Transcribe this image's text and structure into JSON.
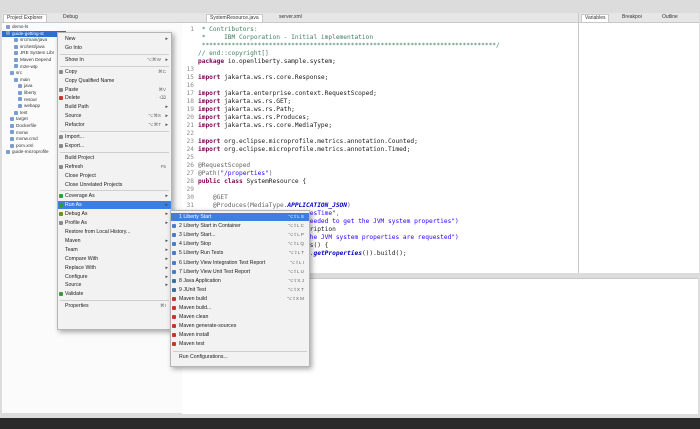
{
  "explorer": {
    "tabs": [
      "Project Explorer",
      "Debug"
    ],
    "tree": [
      {
        "label": "demo-ls",
        "selected": false,
        "indent": 1
      },
      {
        "label": "guide-getting-st",
        "selected": true,
        "indent": 1
      },
      {
        "label": "src/main/java",
        "indent": 3
      },
      {
        "label": "src/test/java",
        "indent": 3
      },
      {
        "label": "JRE System Libr",
        "indent": 3
      },
      {
        "label": "Maven Depend",
        "indent": 3
      },
      {
        "label": "m2e-wtp",
        "indent": 3
      },
      {
        "label": "src",
        "indent": 2
      },
      {
        "label": "main",
        "indent": 3
      },
      {
        "label": "java",
        "indent": 4
      },
      {
        "label": "liberty",
        "indent": 4
      },
      {
        "label": "resour",
        "indent": 4
      },
      {
        "label": "webapp",
        "indent": 4
      },
      {
        "label": "test",
        "indent": 3
      },
      {
        "label": "target",
        "indent": 2
      },
      {
        "label": "Dockerfile",
        "indent": 2
      },
      {
        "label": "mvnw",
        "indent": 2
      },
      {
        "label": "mvnw.cmd",
        "indent": 2
      },
      {
        "label": "pom.xml",
        "indent": 2
      },
      {
        "label": "guide-microprofile",
        "indent": 1
      }
    ]
  },
  "editor": {
    "tabs": [
      "SystemResource.java",
      "server.xml"
    ],
    "right_tabs": [
      "Variables",
      "Breakpoi",
      "Outline"
    ],
    "lines": [
      {
        "n": "1",
        "parts": [
          {
            "t": " * Contributors:",
            "c": "cm"
          }
        ]
      },
      {
        "n": "",
        "parts": [
          {
            "t": " *     IBM Corporation - Initial implementation",
            "c": "cm"
          }
        ]
      },
      {
        "n": "",
        "parts": [
          {
            "t": " *******************************************************************************/",
            "c": "cm"
          }
        ]
      },
      {
        "n": "",
        "parts": [
          {
            "t": "// end::copyright[]",
            "c": "cm"
          }
        ]
      },
      {
        "n": "",
        "parts": [
          {
            "t": "package ",
            "c": "kw"
          },
          {
            "t": "io.openliberty.sample.system;",
            "c": ""
          }
        ]
      },
      {
        "n": "13",
        "parts": []
      },
      {
        "n": "15",
        "parts": [
          {
            "t": "import ",
            "c": "kw"
          },
          {
            "t": "jakarta.ws.rs.core.Response;",
            "c": ""
          }
        ]
      },
      {
        "n": "16",
        "parts": []
      },
      {
        "n": "17",
        "parts": [
          {
            "t": "import ",
            "c": "kw"
          },
          {
            "t": "jakarta.enterprise.context.RequestScoped;",
            "c": ""
          }
        ]
      },
      {
        "n": "18",
        "parts": [
          {
            "t": "import ",
            "c": "kw"
          },
          {
            "t": "jakarta.ws.rs.GET;",
            "c": ""
          }
        ]
      },
      {
        "n": "19",
        "parts": [
          {
            "t": "import ",
            "c": "kw"
          },
          {
            "t": "jakarta.ws.rs.Path;",
            "c": ""
          }
        ]
      },
      {
        "n": "20",
        "parts": [
          {
            "t": "import ",
            "c": "kw"
          },
          {
            "t": "jakarta.ws.rs.Produces;",
            "c": ""
          }
        ]
      },
      {
        "n": "21",
        "parts": [
          {
            "t": "import ",
            "c": "kw"
          },
          {
            "t": "jakarta.ws.rs.core.MediaType;",
            "c": ""
          }
        ]
      },
      {
        "n": "22",
        "parts": []
      },
      {
        "n": "23",
        "parts": [
          {
            "t": "import ",
            "c": "kw"
          },
          {
            "t": "org.eclipse.microprofile.metrics.annotation.Counted;",
            "c": ""
          }
        ]
      },
      {
        "n": "24",
        "parts": [
          {
            "t": "import ",
            "c": "kw"
          },
          {
            "t": "org.eclipse.microprofile.metrics.annotation.Timed;",
            "c": ""
          }
        ]
      },
      {
        "n": "25",
        "parts": []
      },
      {
        "n": "26",
        "parts": [
          {
            "t": "@RequestScoped",
            "c": "an"
          }
        ]
      },
      {
        "n": "27",
        "parts": [
          {
            "t": "@Path(",
            "c": "an"
          },
          {
            "t": "\"/properties\"",
            "c": "st"
          },
          {
            "t": ")",
            "c": "an"
          }
        ]
      },
      {
        "n": "28",
        "parts": [
          {
            "t": "public class ",
            "c": "kw"
          },
          {
            "t": "SystemResource {",
            "c": ""
          }
        ]
      },
      {
        "n": "29",
        "parts": []
      },
      {
        "n": "30",
        "parts": [
          {
            "t": "    @GET",
            "c": "an"
          }
        ]
      },
      {
        "n": "31",
        "parts": [
          {
            "t": "    @Produces(MediaType.",
            "c": "an"
          },
          {
            "t": "APPLICATION_JSON",
            "c": "fd"
          },
          {
            "t": ")",
            "c": "an"
          }
        ]
      },
      {
        "n": "32",
        "parts": [
          {
            "t": "    @Timed(name = ",
            "c": "an"
          },
          {
            "t": "\"getPropertiesTime\"",
            "c": "st"
          },
          {
            "t": ",",
            "c": "an"
          }
        ]
      },
      {
        "n": "33",
        "parts": [
          {
            "t": "                          ",
            "c": ""
          },
          {
            "t": "ne needed to get the JVM system properties\")",
            "c": "st"
          }
        ]
      },
      {
        "n": "34",
        "parts": [
          {
            "t": "                          ",
            "c": ""
          },
          {
            "t": "description",
            "c": ""
          }
        ]
      },
      {
        "n": "35",
        "parts": [
          {
            "t": "                          ",
            "c": ""
          },
          {
            "t": "es the JVM system properties are requested\")",
            "c": "st"
          }
        ]
      },
      {
        "n": "36",
        "parts": [
          {
            "t": "                          ",
            "c": ""
          },
          {
            "t": "rties() {",
            "c": ""
          }
        ]
      },
      {
        "n": "37",
        "parts": [
          {
            "t": "                          ",
            "c": ""
          },
          {
            "t": "stem.",
            "c": ""
          },
          {
            "t": "getProperties",
            "c": "fd"
          },
          {
            "t": "()).build();",
            "c": ""
          }
        ]
      },
      {
        "n": "38",
        "parts": []
      }
    ]
  },
  "context_menu": {
    "items": [
      {
        "label": "New",
        "arrow": true
      },
      {
        "label": "Go Into"
      },
      {
        "sep": true
      },
      {
        "label": "Show In",
        "shortcut": "⌥⌘W",
        "arrow": true
      },
      {
        "sep": true
      },
      {
        "label": "Copy",
        "shortcut": "⌘C",
        "icon": "copy-icon"
      },
      {
        "label": "Copy Qualified Name"
      },
      {
        "label": "Paste",
        "shortcut": "⌘V",
        "icon": "paste-icon"
      },
      {
        "label": "Delete",
        "shortcut": "⌫",
        "icon": "delete-icon"
      },
      {
        "label": "Build Path",
        "arrow": true
      },
      {
        "label": "Source",
        "shortcut": "⌥⌘S",
        "arrow": true
      },
      {
        "label": "Refactor",
        "shortcut": "⌥⌘T",
        "arrow": true
      },
      {
        "sep": true
      },
      {
        "label": "Import...",
        "icon": "import-icon"
      },
      {
        "label": "Export...",
        "icon": "export-icon"
      },
      {
        "sep": true
      },
      {
        "label": "Build Project"
      },
      {
        "label": "Refresh",
        "shortcut": "F5",
        "icon": "refresh-icon"
      },
      {
        "label": "Close Project"
      },
      {
        "label": "Close Unrelated Projects"
      },
      {
        "sep": true
      },
      {
        "label": "Coverage As",
        "arrow": true,
        "icon": "coverage-icon"
      },
      {
        "label": "Run As",
        "arrow": true,
        "icon": "run-icon",
        "highlight": true
      },
      {
        "label": "Debug As",
        "arrow": true,
        "icon": "debug-icon"
      },
      {
        "label": "Profile As",
        "arrow": true,
        "icon": "profile-icon"
      },
      {
        "label": "Restore from Local History..."
      },
      {
        "label": "Maven",
        "arrow": true
      },
      {
        "label": "Team",
        "arrow": true
      },
      {
        "label": "Compare With",
        "arrow": true
      },
      {
        "label": "Replace With",
        "arrow": true
      },
      {
        "label": "Configure",
        "arrow": true
      },
      {
        "label": "Source",
        "arrow": true
      },
      {
        "label": "Validate",
        "icon": "check-icon"
      },
      {
        "sep": true
      },
      {
        "label": "Properties",
        "shortcut": "⌘I"
      }
    ]
  },
  "run_as_menu": {
    "items": [
      {
        "label": "1 Liberty Start",
        "shortcut": "⌥⇧L S",
        "icon": "liberty-icon",
        "highlight": true
      },
      {
        "label": "2 Liberty Start in Container",
        "shortcut": "⌥⇧L C",
        "icon": "liberty-icon"
      },
      {
        "label": "3 Liberty Start...",
        "shortcut": "⌥⇧L P",
        "icon": "liberty-icon"
      },
      {
        "label": "4 Liberty Stop",
        "shortcut": "⌥⇧L Q",
        "icon": "liberty-icon"
      },
      {
        "label": "5 Liberty Run Tests",
        "shortcut": "⌥⇧L T",
        "icon": "liberty-icon"
      },
      {
        "label": "6 Liberty View Integration Test Report",
        "shortcut": "⌥⇧L I",
        "icon": "liberty-icon"
      },
      {
        "label": "7 Liberty View Unit Test Report",
        "shortcut": "⌥⇧L U",
        "icon": "liberty-icon"
      },
      {
        "label": "8 Java Application",
        "shortcut": "⌥⇧X J",
        "icon": "java-icon"
      },
      {
        "label": "9 JUnit Test",
        "shortcut": "⌥⇧X T",
        "icon": "junit-icon"
      },
      {
        "label": "Maven build",
        "shortcut": "⌥⇧X M",
        "icon": "maven-icon"
      },
      {
        "label": "Maven build...",
        "icon": "maven-icon"
      },
      {
        "label": "Maven clean",
        "icon": "maven-icon"
      },
      {
        "label": "Maven generate-sources",
        "icon": "maven-icon"
      },
      {
        "label": "Maven install",
        "icon": "maven-icon"
      },
      {
        "label": "Maven test",
        "icon": "maven-icon"
      },
      {
        "sep": true
      },
      {
        "label": "Run Configurations..."
      }
    ]
  },
  "colors": {
    "highlight": "#3d7ee0",
    "selection": "#2f6fd0",
    "maven_icon": "#c0392b"
  }
}
